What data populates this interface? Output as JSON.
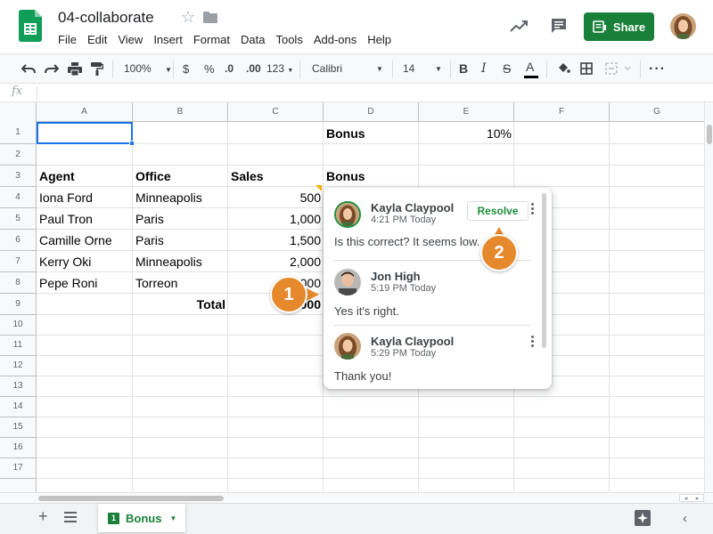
{
  "header": {
    "title": "04-collaborate",
    "menu": [
      "File",
      "Edit",
      "View",
      "Insert",
      "Format",
      "Data",
      "Tools",
      "Add-ons",
      "Help"
    ],
    "share_label": "Share"
  },
  "toolbar": {
    "zoom": "100%",
    "currency": "$",
    "percent": "%",
    "dec_decrease": ".0",
    "dec_increase": ".00",
    "more_formats": "123",
    "font": "Calibri",
    "font_size": "14",
    "bold": "B",
    "italic": "I",
    "strike": "S",
    "text_color": "A"
  },
  "formula_bar": {
    "fx": "fx"
  },
  "grid": {
    "columns": [
      "A",
      "B",
      "C",
      "D",
      "E",
      "F",
      "G"
    ],
    "rows": [
      "1",
      "2",
      "3",
      "4",
      "5",
      "6",
      "7",
      "8",
      "9",
      "10",
      "11",
      "12",
      "13",
      "14",
      "15",
      "16",
      "17"
    ],
    "cells": {
      "D1": "Bonus",
      "E1": "10%",
      "A3": "Agent",
      "B3": "Office",
      "C3": "Sales",
      "D3": "Bonus",
      "A4": "Iona Ford",
      "B4": "Minneapolis",
      "C4": "500",
      "A5": "Paul Tron",
      "B5": "Paris",
      "C5": "1,000",
      "A6": "Camille Orne",
      "B6": "Paris",
      "C6": "1,500",
      "A7": "Kerry Oki",
      "B7": "Minneapolis",
      "C7": "2,000",
      "A8": "Pepe Roni",
      "B8": "Torreon",
      "C8": "000",
      "B9": "Total",
      "C9": "000"
    }
  },
  "comments": [
    {
      "author": "Kayla Claypool",
      "time": "4:21 PM Today",
      "text": "Is this correct? It seems low."
    },
    {
      "author": "Jon High",
      "time": "5:19 PM Today",
      "text": "Yes it's right."
    },
    {
      "author": "Kayla Claypool",
      "time": "5:29 PM Today",
      "text": "Thank you!"
    }
  ],
  "comment_panel": {
    "resolve_label": "Resolve"
  },
  "steps": [
    "1",
    "2"
  ],
  "sheet_tab": {
    "badge": "1",
    "label": "Bonus"
  },
  "bottom": {
    "add": "+",
    "collapse": "‹"
  },
  "colors": {
    "brand_green": "#188038",
    "selection_blue": "#1a73e8",
    "step_orange": "#e6892c",
    "comment_marker": "#f9ab00"
  }
}
